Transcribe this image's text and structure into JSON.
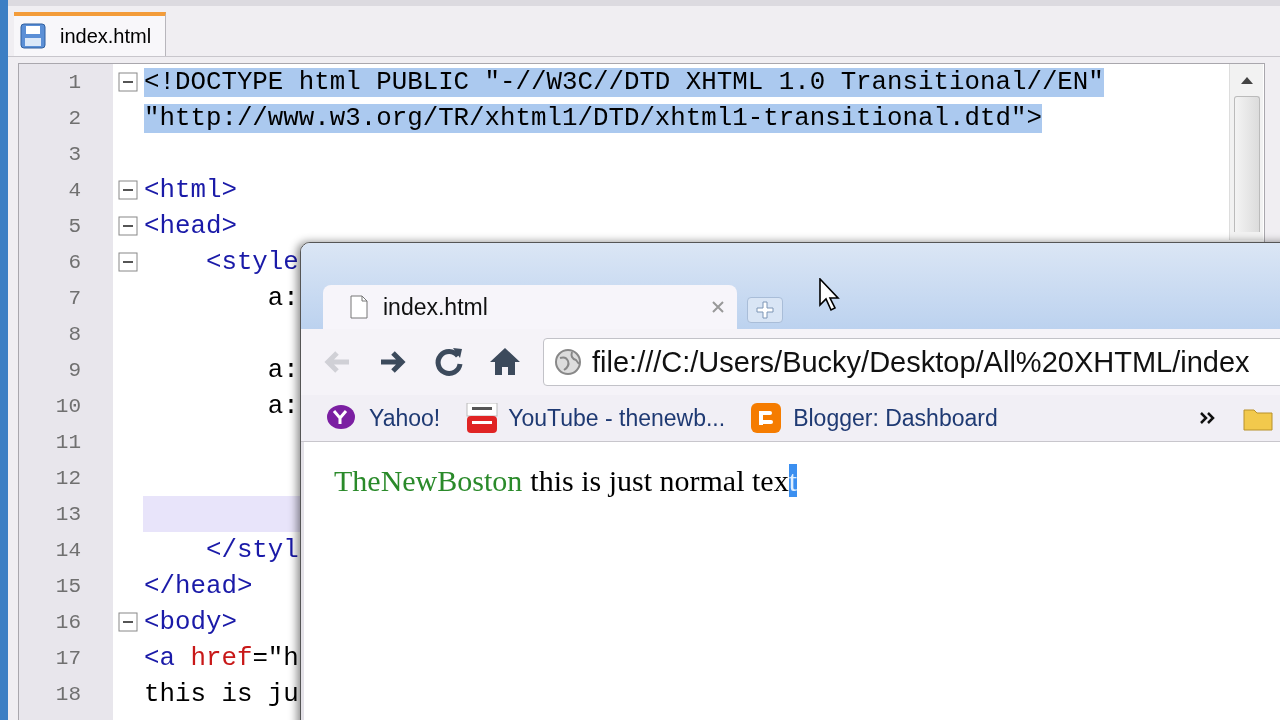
{
  "editor": {
    "tab": {
      "label": "index.html",
      "selected": true
    },
    "lines": [
      {
        "number": "1",
        "fold": true,
        "selected": true,
        "current": false,
        "tokens": [
          {
            "kind": "plain",
            "text": "<!DOCTYPE html PUBLIC \"-//W3C//DTD XHTML 1.0 Transitional//EN\""
          }
        ]
      },
      {
        "number": "2",
        "fold": false,
        "selected": true,
        "current": false,
        "tokens": [
          {
            "kind": "plain",
            "text": "\"http://www.w3.org/TR/xhtml1/DTD/xhtml1-transitional.dtd\">"
          }
        ]
      },
      {
        "number": "3",
        "fold": false,
        "selected": false,
        "current": false
      },
      {
        "number": "4",
        "fold": true,
        "selected": false,
        "current": false,
        "tokens": [
          {
            "kind": "tag",
            "text": "<html>"
          }
        ]
      },
      {
        "number": "5",
        "fold": true,
        "selected": false,
        "current": false,
        "tokens": [
          {
            "kind": "tag",
            "text": "<head>"
          }
        ]
      },
      {
        "number": "6",
        "fold": true,
        "selected": false,
        "current": false,
        "tokens": [
          {
            "kind": "tag",
            "text": "    <style"
          }
        ]
      },
      {
        "number": "7",
        "fold": false,
        "selected": false,
        "current": false,
        "tokens": [
          {
            "kind": "plain",
            "text": "        a:"
          }
        ]
      },
      {
        "number": "8",
        "fold": false,
        "selected": false,
        "current": false
      },
      {
        "number": "9",
        "fold": false,
        "selected": false,
        "current": false,
        "tokens": [
          {
            "kind": "plain",
            "text": "        a:"
          }
        ]
      },
      {
        "number": "10",
        "fold": false,
        "selected": false,
        "current": false,
        "tokens": [
          {
            "kind": "plain",
            "text": "        a:"
          }
        ]
      },
      {
        "number": "11",
        "fold": false,
        "selected": false,
        "current": false
      },
      {
        "number": "12",
        "fold": false,
        "selected": false,
        "current": false
      },
      {
        "number": "13",
        "fold": false,
        "selected": false,
        "current": true
      },
      {
        "number": "14",
        "fold": false,
        "selected": false,
        "current": false,
        "tokens": [
          {
            "kind": "tag",
            "text": "    </styl"
          }
        ]
      },
      {
        "number": "15",
        "fold": false,
        "selected": false,
        "current": false,
        "tokens": [
          {
            "kind": "tag",
            "text": "</head>"
          }
        ]
      },
      {
        "number": "16",
        "fold": true,
        "selected": false,
        "current": false,
        "tokens": [
          {
            "kind": "tag",
            "text": "<body>"
          }
        ]
      },
      {
        "number": "17",
        "fold": false,
        "selected": false,
        "current": false,
        "tokens": [
          {
            "kind": "tag",
            "text": "<a"
          },
          {
            "kind": "attr",
            "text": " href"
          },
          {
            "kind": "plain",
            "text": "=\"h"
          }
        ]
      },
      {
        "number": "18",
        "fold": false,
        "selected": false,
        "current": false,
        "tokens": [
          {
            "kind": "plain",
            "text": "this is ju"
          }
        ]
      }
    ]
  },
  "browser": {
    "tabs": [
      {
        "label": "index.html",
        "selected": true
      }
    ],
    "nav_buttons": [
      {
        "kind": "back",
        "disabled": true
      },
      {
        "kind": "forward",
        "disabled": false
      },
      {
        "kind": "reload",
        "disabled": false
      },
      {
        "kind": "home",
        "disabled": false
      }
    ],
    "address": "file:///C:/Users/Bucky/Desktop/All%20XHTML/index",
    "bookmarks": [
      {
        "kind": "yahoo",
        "label": "Yahoo!"
      },
      {
        "kind": "youtube",
        "label": "YouTube - thenewb..."
      },
      {
        "kind": "blogger",
        "label": "Blogger: Dashboard"
      }
    ],
    "page": {
      "link": "TheNewBoston",
      "text": "this is just normal tex",
      "selected_text": "t"
    }
  }
}
